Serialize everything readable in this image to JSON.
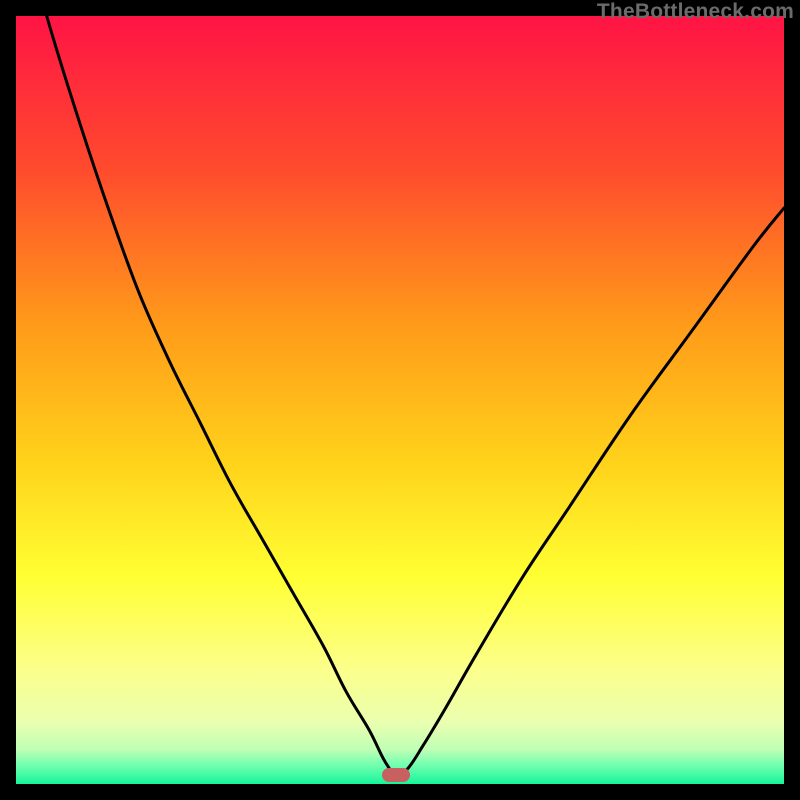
{
  "watermark": "TheBottleneck.com",
  "colors": {
    "frame": "#000000",
    "marker": "#c86060",
    "curve": "#000000",
    "gradient_stops": [
      {
        "pct": 0,
        "color": "#ff1445"
      },
      {
        "pct": 20,
        "color": "#ff4b2d"
      },
      {
        "pct": 40,
        "color": "#ff9a1a"
      },
      {
        "pct": 58,
        "color": "#ffd21a"
      },
      {
        "pct": 73,
        "color": "#ffff33"
      },
      {
        "pct": 85,
        "color": "#fcff8a"
      },
      {
        "pct": 92,
        "color": "#eaffb0"
      },
      {
        "pct": 95.5,
        "color": "#bfffb5"
      },
      {
        "pct": 97.5,
        "color": "#74ffb0"
      },
      {
        "pct": 100,
        "color": "#15f59a"
      }
    ]
  },
  "chart_data": {
    "type": "line",
    "title": "",
    "xlabel": "",
    "ylabel": "",
    "xlim": [
      0,
      100
    ],
    "ylim": [
      0,
      100
    ],
    "legend": false,
    "grid": false,
    "annotations": [
      "TheBottleneck.com"
    ],
    "marker": {
      "x": 49.5,
      "y": 1.2
    },
    "series": [
      {
        "name": "bottleneck-curve",
        "x": [
          0,
          4,
          8,
          12,
          16,
          20,
          24,
          28,
          32,
          36,
          40,
          43,
          46,
          48,
          49.5,
          51,
          53,
          56,
          60,
          66,
          72,
          80,
          88,
          96,
          100
        ],
        "y": [
          115,
          100,
          87,
          75,
          64,
          55,
          47,
          39,
          32,
          25,
          18,
          12,
          7,
          3,
          1.2,
          2,
          5,
          10,
          17,
          27,
          36,
          48,
          59,
          70,
          75
        ]
      }
    ]
  }
}
